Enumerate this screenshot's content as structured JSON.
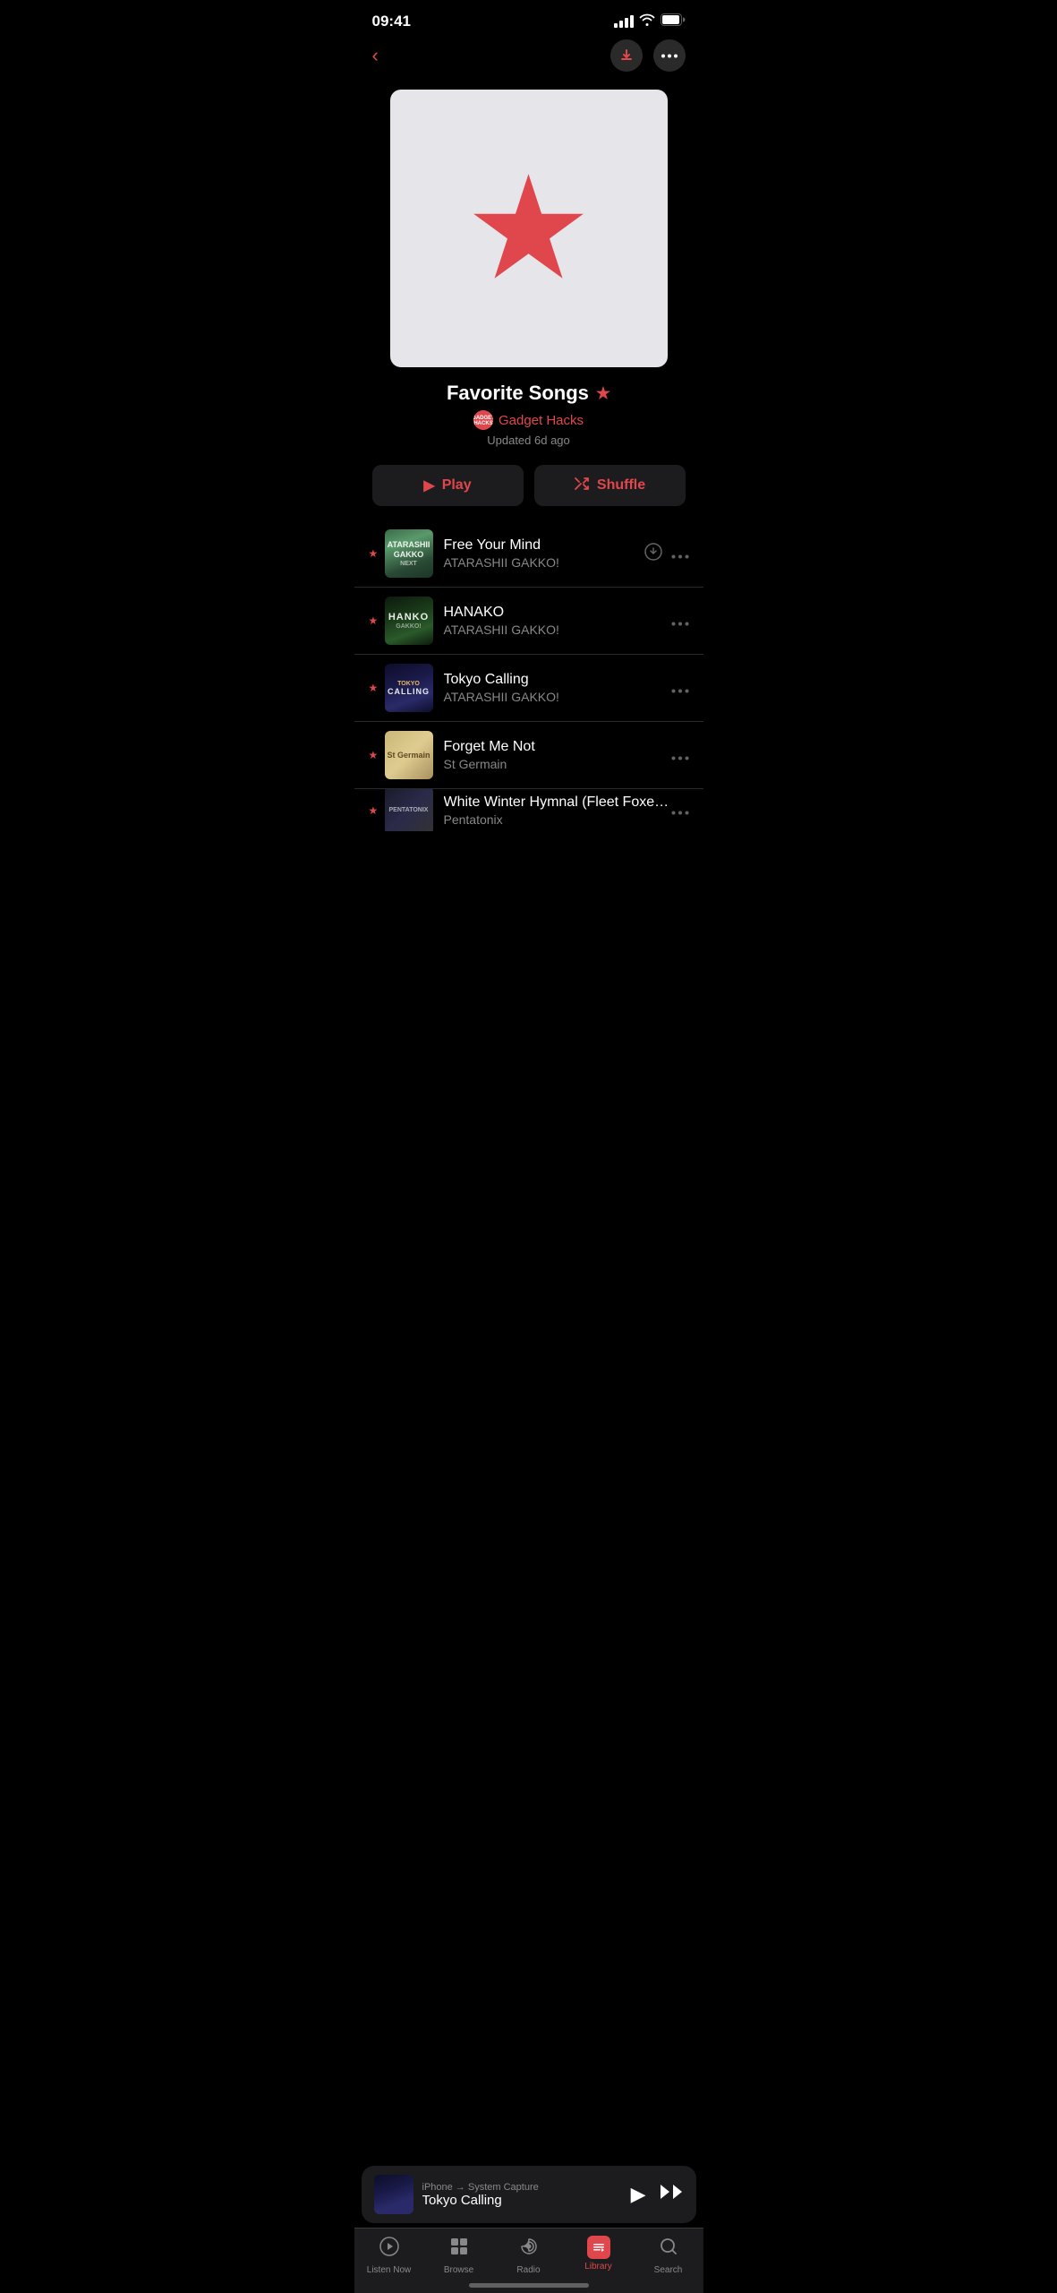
{
  "statusBar": {
    "time": "09:41"
  },
  "nav": {
    "backLabel": "‹",
    "downloadLabel": "↓",
    "moreLabel": "•••"
  },
  "playlist": {
    "artAlt": "Favorite Songs playlist artwork with red star",
    "title": "Favorite Songs",
    "authorName": "Gadget Hacks",
    "authorInitials": "G\nH",
    "updated": "Updated 6d ago",
    "playLabel": "Play",
    "shuffleLabel": "Shuffle"
  },
  "songs": [
    {
      "title": "Free Your Mind",
      "artist": "ATARASHII GAKKO!",
      "hasStar": true,
      "hasDownload": true,
      "thumbClass": "thumb-green-art"
    },
    {
      "title": "HANAKO",
      "artist": "ATARASHII GAKKO!",
      "hasStar": true,
      "hasDownload": false,
      "thumbClass": "thumb-hanako-art"
    },
    {
      "title": "Tokyo Calling",
      "artist": "ATARASHII GAKKO!",
      "hasStar": true,
      "hasDownload": false,
      "thumbClass": "thumb-tokyo-art"
    },
    {
      "title": "Forget Me Not",
      "artist": "St Germain",
      "hasStar": true,
      "hasDownload": false,
      "thumbClass": "thumb-stgermain"
    },
    {
      "title": "White Winter Hymnal (Fleet Foxes Cover)",
      "artist": "Pentatonix",
      "hasStar": true,
      "hasDownload": false,
      "thumbClass": "thumb-pentatonix",
      "partial": true
    }
  ],
  "miniPlayer": {
    "route": "iPhone → System Capture",
    "title": "Tokyo Calling",
    "thumbClass": "thumb-tokyo-art"
  },
  "tabBar": {
    "items": [
      {
        "id": "listen-now",
        "label": "Listen Now",
        "icon": "▶"
      },
      {
        "id": "browse",
        "label": "Browse",
        "icon": "⊞"
      },
      {
        "id": "radio",
        "label": "Radio",
        "icon": "((·))"
      },
      {
        "id": "library",
        "label": "Library",
        "icon": "♪",
        "active": true
      },
      {
        "id": "search",
        "label": "Search",
        "icon": "⌕"
      }
    ]
  }
}
